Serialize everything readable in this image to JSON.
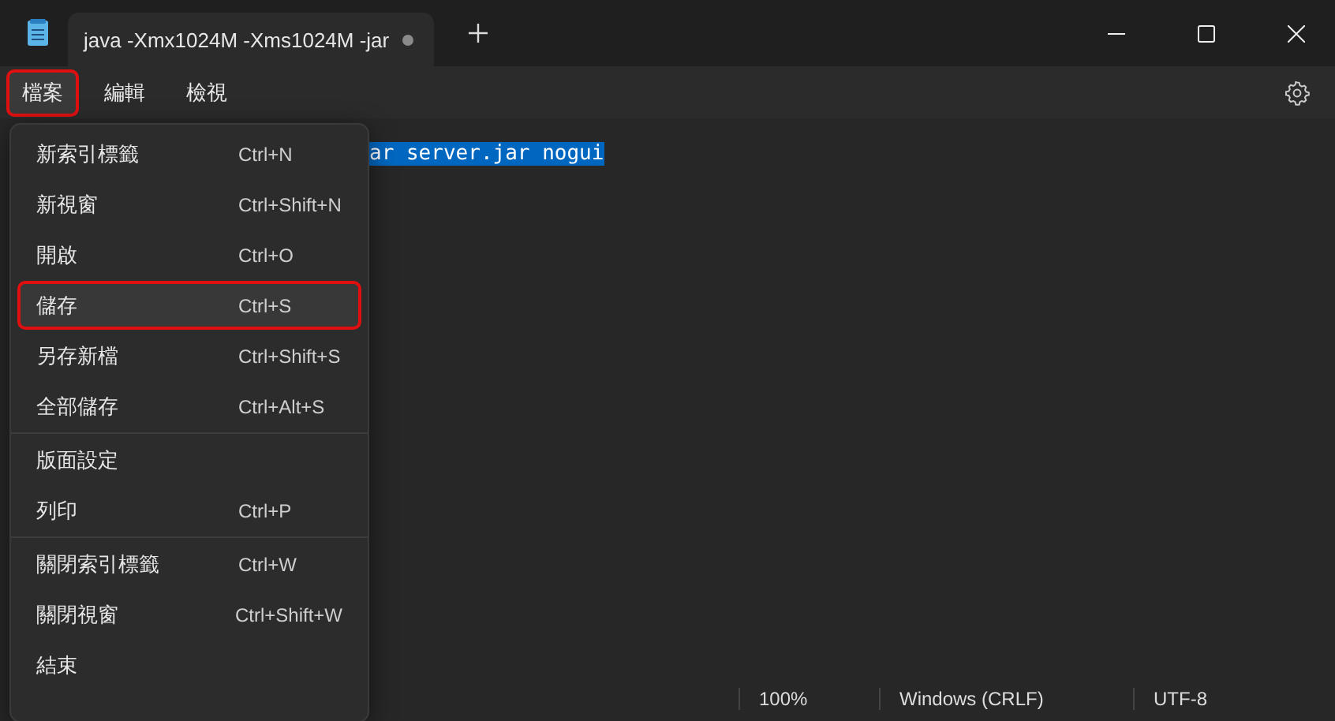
{
  "window": {
    "tab_title": "java -Xmx1024M -Xms1024M -jar",
    "tab_modified": true
  },
  "menubar": [
    {
      "label": "檔案",
      "selected": true,
      "highlighted": true
    },
    {
      "label": "編輯",
      "selected": false,
      "highlighted": false
    },
    {
      "label": "檢視",
      "selected": false,
      "highlighted": false
    }
  ],
  "editor": {
    "line": "ar server.jar nogui",
    "selected": true
  },
  "file_menu": {
    "groups": [
      [
        {
          "label": "新索引標籤",
          "shortcut": "Ctrl+N",
          "highlighted": false
        },
        {
          "label": "新視窗",
          "shortcut": "Ctrl+Shift+N",
          "highlighted": false
        },
        {
          "label": "開啟",
          "shortcut": "Ctrl+O",
          "highlighted": false
        },
        {
          "label": "儲存",
          "shortcut": "Ctrl+S",
          "highlighted": true
        },
        {
          "label": "另存新檔",
          "shortcut": "Ctrl+Shift+S",
          "highlighted": false
        },
        {
          "label": "全部儲存",
          "shortcut": "Ctrl+Alt+S",
          "highlighted": false
        }
      ],
      [
        {
          "label": "版面設定",
          "highlighted": false
        },
        {
          "label": "列印",
          "shortcut": "Ctrl+P",
          "highlighted": false
        }
      ],
      [
        {
          "label": "關閉索引標籤",
          "shortcut": "Ctrl+W",
          "highlighted": false
        },
        {
          "label": "關閉視窗",
          "shortcut": "Ctrl+Shift+W",
          "highlighted": false
        },
        {
          "label": "結束",
          "highlighted": false
        }
      ]
    ]
  },
  "status_bar": {
    "zoom": "100%",
    "line_ending": "Windows (CRLF)",
    "encoding": "UTF-8"
  }
}
